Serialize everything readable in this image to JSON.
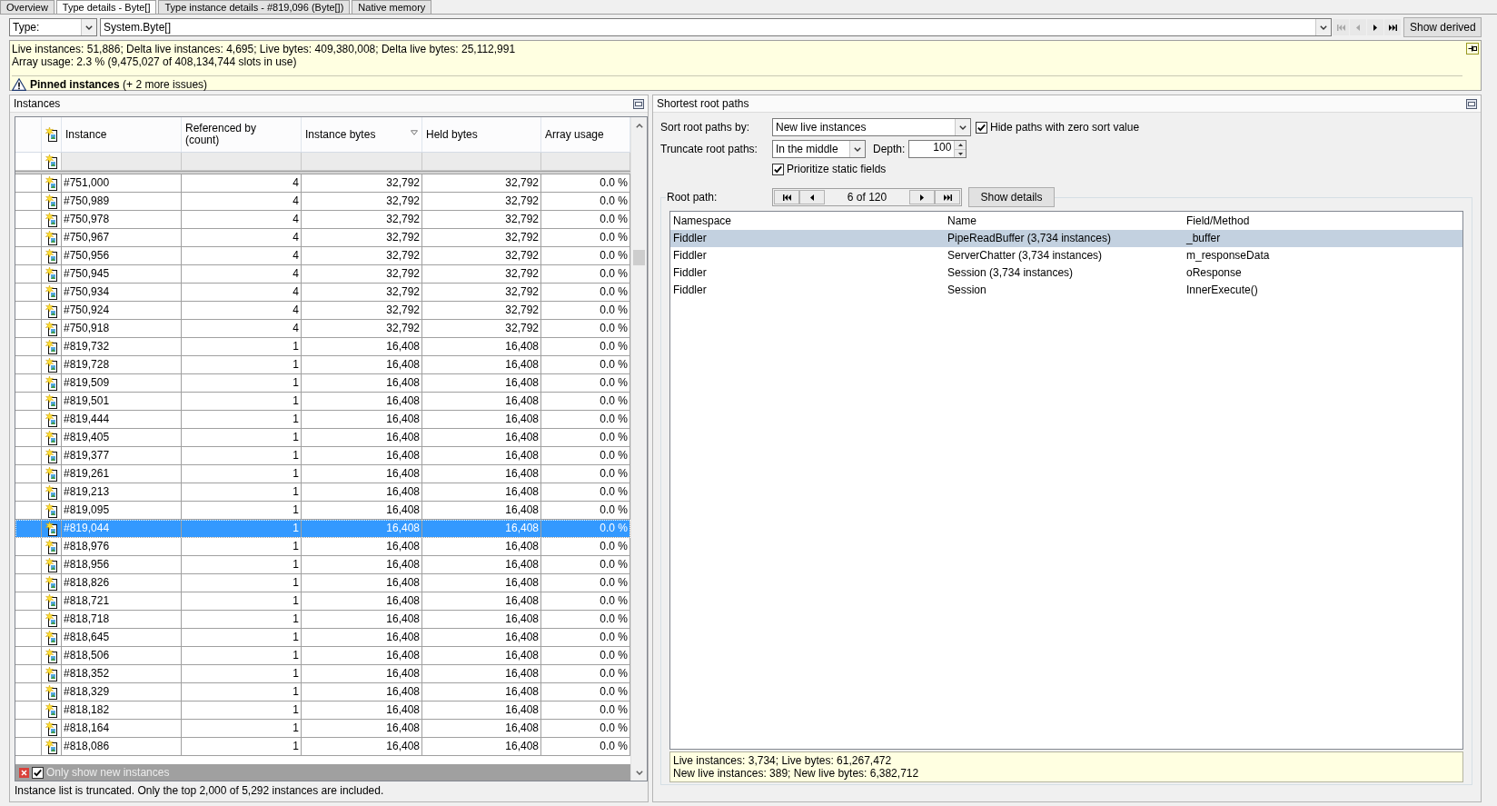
{
  "tabs": [
    {
      "label": "Overview",
      "selected": false
    },
    {
      "label": "Type details - Byte[]",
      "selected": true
    },
    {
      "label": "Type instance details - #819,096 (Byte[])",
      "selected": false
    },
    {
      "label": "Native memory",
      "selected": false
    }
  ],
  "type_filter": {
    "label": "Type:",
    "value": "System.Byte[]"
  },
  "type_navigation": [
    {
      "kind": "first",
      "disabled": true
    },
    {
      "kind": "previous",
      "disabled": true
    },
    {
      "kind": "next",
      "disabled": false
    },
    {
      "kind": "last",
      "disabled": false
    }
  ],
  "show_derived_button": "Show derived",
  "summary": {
    "lines": [
      "Live instances: 51,886; Delta live instances: 4,695; Live bytes: 409,380,008; Delta live bytes: 25,112,991",
      "Array usage: 2.3 % (9,475,027 of 408,134,744 slots in use)"
    ],
    "issue": "**Pinned instances** (+ 2 more issues)"
  },
  "instances": {
    "title": "Instances",
    "columns": [
      {
        "label": "Instance",
        "sorted": false
      },
      {
        "label": "Referenced by\n(count)",
        "sorted": false
      },
      {
        "label": "Instance bytes",
        "sorted": true
      },
      {
        "label": "Held bytes",
        "sorted": false
      },
      {
        "label": "Array usage",
        "sorted": false
      }
    ],
    "rows": [
      {
        "cells": [
          "#751,000",
          "4",
          "32,792",
          "32,792",
          "0.0 %"
        ],
        "selected": false
      },
      {
        "cells": [
          "#750,989",
          "4",
          "32,792",
          "32,792",
          "0.0 %"
        ],
        "selected": false
      },
      {
        "cells": [
          "#750,978",
          "4",
          "32,792",
          "32,792",
          "0.0 %"
        ],
        "selected": false
      },
      {
        "cells": [
          "#750,967",
          "4",
          "32,792",
          "32,792",
          "0.0 %"
        ],
        "selected": false
      },
      {
        "cells": [
          "#750,956",
          "4",
          "32,792",
          "32,792",
          "0.0 %"
        ],
        "selected": false
      },
      {
        "cells": [
          "#750,945",
          "4",
          "32,792",
          "32,792",
          "0.0 %"
        ],
        "selected": false
      },
      {
        "cells": [
          "#750,934",
          "4",
          "32,792",
          "32,792",
          "0.0 %"
        ],
        "selected": false
      },
      {
        "cells": [
          "#750,924",
          "4",
          "32,792",
          "32,792",
          "0.0 %"
        ],
        "selected": false
      },
      {
        "cells": [
          "#750,918",
          "4",
          "32,792",
          "32,792",
          "0.0 %"
        ],
        "selected": false
      },
      {
        "cells": [
          "#819,732",
          "1",
          "16,408",
          "16,408",
          "0.0 %"
        ],
        "selected": false
      },
      {
        "cells": [
          "#819,728",
          "1",
          "16,408",
          "16,408",
          "0.0 %"
        ],
        "selected": false
      },
      {
        "cells": [
          "#819,509",
          "1",
          "16,408",
          "16,408",
          "0.0 %"
        ],
        "selected": false
      },
      {
        "cells": [
          "#819,501",
          "1",
          "16,408",
          "16,408",
          "0.0 %"
        ],
        "selected": false
      },
      {
        "cells": [
          "#819,444",
          "1",
          "16,408",
          "16,408",
          "0.0 %"
        ],
        "selected": false
      },
      {
        "cells": [
          "#819,405",
          "1",
          "16,408",
          "16,408",
          "0.0 %"
        ],
        "selected": false
      },
      {
        "cells": [
          "#819,377",
          "1",
          "16,408",
          "16,408",
          "0.0 %"
        ],
        "selected": false
      },
      {
        "cells": [
          "#819,261",
          "1",
          "16,408",
          "16,408",
          "0.0 %"
        ],
        "selected": false
      },
      {
        "cells": [
          "#819,213",
          "1",
          "16,408",
          "16,408",
          "0.0 %"
        ],
        "selected": false
      },
      {
        "cells": [
          "#819,095",
          "1",
          "16,408",
          "16,408",
          "0.0 %"
        ],
        "selected": false
      },
      {
        "cells": [
          "#819,044",
          "1",
          "16,408",
          "16,408",
          "0.0 %"
        ],
        "selected": true
      },
      {
        "cells": [
          "#818,976",
          "1",
          "16,408",
          "16,408",
          "0.0 %"
        ],
        "selected": false
      },
      {
        "cells": [
          "#818,956",
          "1",
          "16,408",
          "16,408",
          "0.0 %"
        ],
        "selected": false
      },
      {
        "cells": [
          "#818,826",
          "1",
          "16,408",
          "16,408",
          "0.0 %"
        ],
        "selected": false
      },
      {
        "cells": [
          "#818,721",
          "1",
          "16,408",
          "16,408",
          "0.0 %"
        ],
        "selected": false
      },
      {
        "cells": [
          "#818,718",
          "1",
          "16,408",
          "16,408",
          "0.0 %"
        ],
        "selected": false
      },
      {
        "cells": [
          "#818,645",
          "1",
          "16,408",
          "16,408",
          "0.0 %"
        ],
        "selected": false
      },
      {
        "cells": [
          "#818,506",
          "1",
          "16,408",
          "16,408",
          "0.0 %"
        ],
        "selected": false
      },
      {
        "cells": [
          "#818,352",
          "1",
          "16,408",
          "16,408",
          "0.0 %"
        ],
        "selected": false
      },
      {
        "cells": [
          "#818,329",
          "1",
          "16,408",
          "16,408",
          "0.0 %"
        ],
        "selected": false
      },
      {
        "cells": [
          "#818,182",
          "1",
          "16,408",
          "16,408",
          "0.0 %"
        ],
        "selected": false
      },
      {
        "cells": [
          "#818,164",
          "1",
          "16,408",
          "16,408",
          "0.0 %"
        ],
        "selected": false
      },
      {
        "cells": [
          "#818,086",
          "1",
          "16,408",
          "16,408",
          "0.0 %"
        ],
        "selected": false
      }
    ],
    "filter_bar": {
      "label": "Only show new instances",
      "checked": true
    },
    "status": "Instance list is truncated. Only the top 2,000 of 5,292 instances are included."
  },
  "root_paths": {
    "title": "Shortest root paths",
    "sort_by": {
      "label": "Sort root paths by:",
      "value": "New live instances"
    },
    "hide_zero": {
      "label": "Hide paths with zero sort value",
      "checked": true
    },
    "truncate": {
      "label": "Truncate root paths:",
      "value": "In the middle"
    },
    "depth": {
      "label": "Depth:",
      "value": "100"
    },
    "prioritize_static": {
      "label": "Prioritize static fields",
      "checked": true
    },
    "root_path": {
      "label": "Root path:",
      "nav_back": [
        {
          "kind": "first"
        },
        {
          "kind": "previous"
        }
      ],
      "position": "6 of 120",
      "nav_forward": [
        {
          "kind": "next"
        },
        {
          "kind": "last"
        }
      ],
      "show_details_button": "Show details"
    },
    "table": {
      "columns": [
        "Namespace",
        "Name",
        "Field/Method"
      ],
      "rows": [
        {
          "cells": [
            "Fiddler",
            "PipeReadBuffer (3,734 instances)",
            "_buffer"
          ],
          "selected": true
        },
        {
          "cells": [
            "Fiddler",
            "ServerChatter (3,734 instances)",
            "m_responseData"
          ],
          "selected": false
        },
        {
          "cells": [
            "Fiddler",
            "Session (3,734 instances)",
            "oResponse"
          ],
          "selected": false
        },
        {
          "cells": [
            "Fiddler",
            "Session",
            "InnerExecute()"
          ],
          "selected": false
        }
      ]
    },
    "summary": [
      "Live instances: 3,734; Live bytes: 61,267,472",
      "New live instances: 389; New live bytes: 6,382,712"
    ]
  }
}
